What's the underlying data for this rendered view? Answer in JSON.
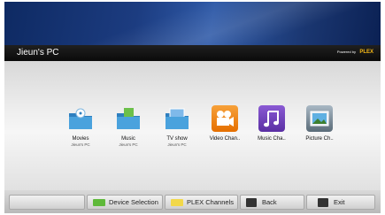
{
  "header": {
    "title": "Jieun's PC",
    "powered_by": "Powered by",
    "brand": "PLEX"
  },
  "tiles": [
    {
      "label": "Movies",
      "sub": "Jieun's PC",
      "icon": "movies-folder-icon"
    },
    {
      "label": "Music",
      "sub": "Jieun's PC",
      "icon": "music-folder-icon"
    },
    {
      "label": "TV show",
      "sub": "Jieun's PC",
      "icon": "tv-folder-icon"
    },
    {
      "label": "Video Chan..",
      "icon": "video-camera-icon"
    },
    {
      "label": "Music Cha..",
      "icon": "music-note-icon"
    },
    {
      "label": "Picture Ch..",
      "icon": "picture-icon"
    }
  ],
  "footer": {
    "device_selection": "Device Selection",
    "plex_channels": "PLEX Channels",
    "back": "Back",
    "exit": "Exit",
    "colors": {
      "green": "#5fb93a",
      "yellow": "#f2d84a"
    }
  },
  "colors": {
    "accent_blue": "#1c3c80",
    "video_orange": "#f07e13",
    "music_purple": "#6a3fb4",
    "picture_blue": "#4fa7d4"
  }
}
